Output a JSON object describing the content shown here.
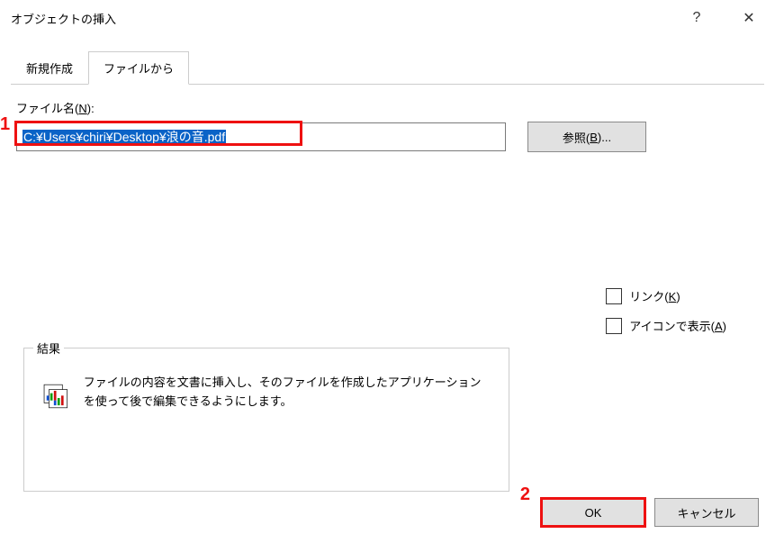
{
  "window": {
    "title": "オブジェクトの挿入",
    "help_symbol": "?",
    "close_symbol": "✕"
  },
  "tabs": {
    "new_create": "新規作成",
    "from_file": "ファイルから"
  },
  "filename": {
    "label_pre": "ファイル名(",
    "label_u": "N",
    "label_post": "):",
    "value": "C:¥Users¥chiri¥Desktop¥浪の音.pdf",
    "browse_pre": "参照(",
    "browse_u": "B",
    "browse_post": ")..."
  },
  "checks": {
    "link_pre": "リンク(",
    "link_u": "K",
    "link_post": ")",
    "asicon_pre": "アイコンで表示(",
    "asicon_u": "A",
    "asicon_post": ")"
  },
  "result": {
    "legend": "結果",
    "desc": "ファイルの内容を文書に挿入し、そのファイルを作成したアプリケーションを使って後で編集できるようにします。"
  },
  "footer": {
    "ok": "OK",
    "cancel": "キャンセル"
  },
  "annotations": {
    "one": "1",
    "two": "2"
  }
}
